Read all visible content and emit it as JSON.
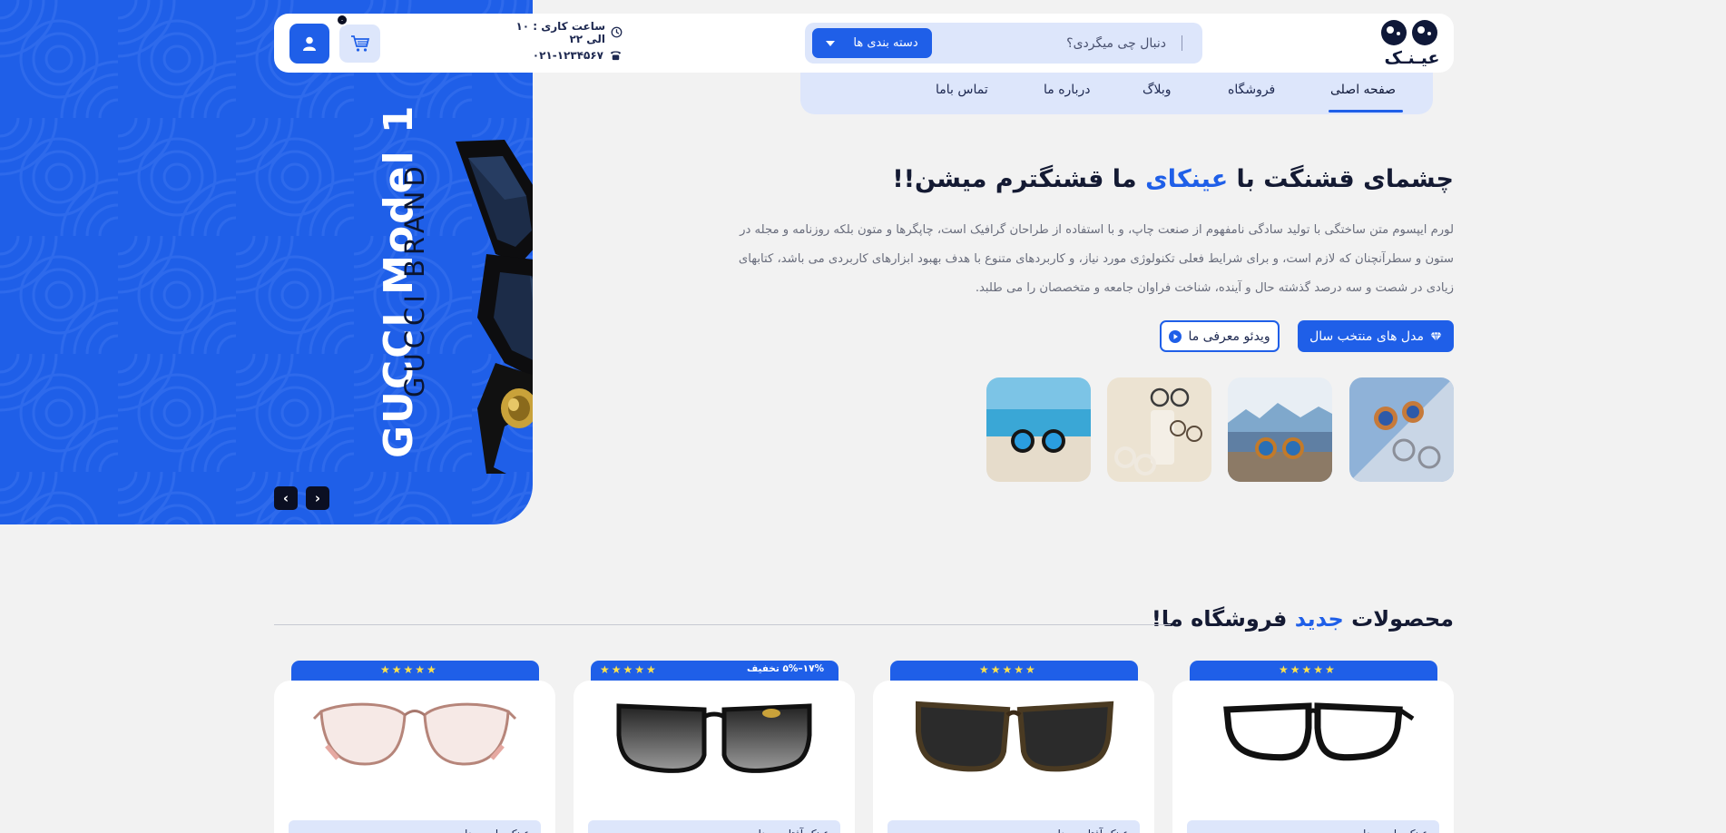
{
  "brand": {
    "logo_text": "عیـنـک"
  },
  "search": {
    "placeholder": "دنبال چی میگردی؟",
    "category_label": "دسته بندی ها"
  },
  "contact": {
    "hours": "ساعت کاری : ۱۰ الی ۲۲",
    "phone": "۰۲۱-۱۲۳۴۵۶۷"
  },
  "cart": {
    "count": "۰"
  },
  "nav": {
    "home": "صفحه اصلی",
    "shop": "فروشگاه",
    "blog": "وبلاگ",
    "about": "درباره ما",
    "contact": "تماس باما"
  },
  "hero": {
    "title_part1": "چشمای قشنگت با ",
    "title_accent": "عینکای",
    "title_part2": " ما قشنگترم میشن!!",
    "description": "لورم ایپسوم متن ساختگی با تولید سادگی نامفهوم از صنعت چاپ، و با استفاده از طراحان گرافیک است، چاپگرها و متون بلکه روزنامه و مجله در ستون و سطرآنچنان که لازم است، و برای شرایط فعلی تکنولوژی مورد نیاز، و کاربردهای متنوع با هدف بهبود ابزارهای کاربردی می باشد، کتابهای زیادی در شصت و سه درصد گذشته حال و آینده، شناخت فراوان جامعه و متخصصان را می طلبد.",
    "primary_button": "مدل های منتخب سال",
    "video_button": "ویدئو معرفی ما"
  },
  "slider": {
    "model_title": "GUCCI Model 1",
    "brand_title": "GUCCI BRAND",
    "prev_label": "‹",
    "next_label": "›"
  },
  "products_section": {
    "title_part1": "محصولات ",
    "title_accent": "جدید",
    "title_part2": " فروشگاه ما!",
    "products": [
      {
        "stars": "★★★★★",
        "discount": "",
        "name": "عینک طبی مدل ..."
      },
      {
        "stars": "★★★★★",
        "discount": "",
        "name": "عینک آفتابی مدل ..."
      },
      {
        "stars": "★★★★★",
        "discount": "۱۷%–۵% تخفیف",
        "name": "عینک آفتابی مدل ..."
      },
      {
        "stars": "★★★★★",
        "discount": "",
        "name": "عینک طبی مدل ..."
      }
    ]
  },
  "colors": {
    "accent": "#1f5fe8",
    "light_accent": "#dde6fb",
    "dark": "#0b0f22",
    "star": "#ffe14a"
  },
  "icons": [
    "logo-eyes-icon",
    "clock-icon",
    "phone-icon",
    "cart-icon",
    "user-icon",
    "diamond-icon",
    "play-icon",
    "chevron-left-icon",
    "chevron-right-icon"
  ]
}
